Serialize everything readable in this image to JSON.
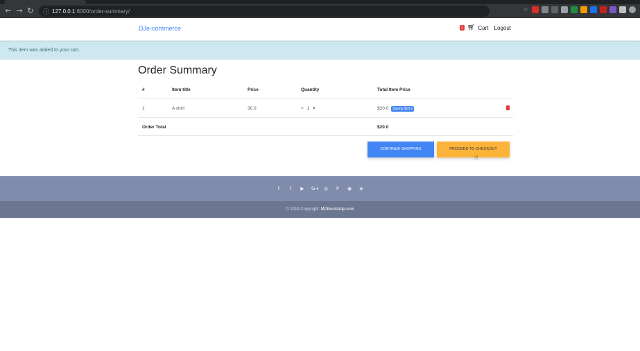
{
  "browser": {
    "tab_title": "127.0.0.1:8000/order-summary",
    "url_host": "127.0.0.1",
    "url_path": ":8000/order-summary/",
    "extensions": [
      {
        "icon": "star-icon",
        "color": "#35363a"
      },
      {
        "icon": "ext-red-icon",
        "color": "#d93025"
      },
      {
        "icon": "ext-gray-icon",
        "color": "#80868b"
      },
      {
        "icon": "ext-dark-icon",
        "color": "#5f6368"
      },
      {
        "icon": "ext-white-icon",
        "color": "#9aa0a6"
      },
      {
        "icon": "ext-green-icon",
        "color": "#1e8e3e"
      },
      {
        "icon": "ext-orange-icon",
        "color": "#f29900"
      },
      {
        "icon": "ext-blue-icon",
        "color": "#1a73e8"
      },
      {
        "icon": "ext-red2-icon",
        "color": "#c5221f"
      },
      {
        "icon": "ext-purple-icon",
        "color": "#7e57c2"
      },
      {
        "icon": "ext-light-icon",
        "color": "#bdc1c6"
      },
      {
        "icon": "ext-person-icon",
        "color": "#9aa0a6"
      }
    ]
  },
  "navbar": {
    "brand": "DJe-commerce",
    "cart_count": "1",
    "cart_label": "Cart",
    "logout_label": "Logout"
  },
  "alert": {
    "message": "This item was added to your cart."
  },
  "order": {
    "title": "Order Summary",
    "headers": [
      "#",
      "Item title",
      "Price",
      "Quantity",
      "Total Item Price"
    ],
    "items": [
      {
        "index": "1",
        "title": "A shirt",
        "price": "30.0",
        "minus": "−",
        "quantity": "1",
        "plus": "+",
        "total": "$20.0",
        "saving": "Saving $10.0"
      }
    ],
    "total_label": "Order Total",
    "total_value": "$20.0",
    "continue_label": "Continue shopping",
    "checkout_label": "Proceed to checkout"
  },
  "footer": {
    "social_icons": [
      "f",
      "t",
      "▶",
      "G+",
      "◎",
      "P",
      "◉",
      "◈"
    ],
    "copyright": "© 2019 Copyright:",
    "copyright_link": "MDBootstrap.com"
  },
  "colors": {
    "brand": "#4285f4",
    "alert_bg": "#cde8f0",
    "continue_bg": "#4285f4",
    "checkout_bg": "#fbb339",
    "footer_bg": "#7f8cab",
    "copyright_bg": "#6b7691"
  }
}
